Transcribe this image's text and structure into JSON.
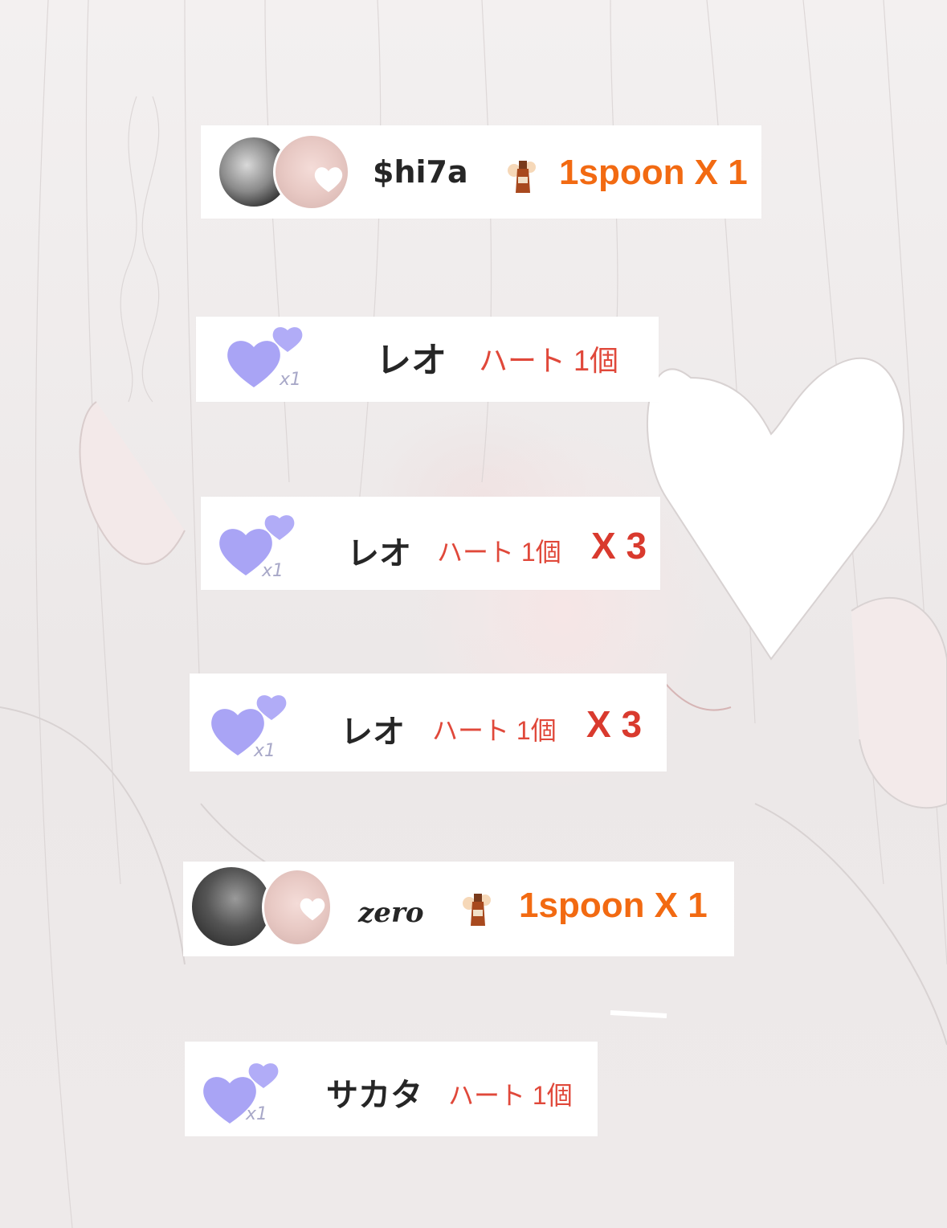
{
  "feed": [
    {
      "kind": "spoon",
      "username": "$hi7a",
      "gift_label": "1spoon X 1"
    },
    {
      "kind": "heart",
      "username": "レオ",
      "gift_label": "ハート 1個",
      "badge_count": "x1",
      "multiplier": ""
    },
    {
      "kind": "heart",
      "username": "レオ",
      "gift_label": "ハート 1個",
      "badge_count": "x1",
      "multiplier": "X 3"
    },
    {
      "kind": "heart",
      "username": "レオ",
      "gift_label": "ハート 1個",
      "badge_count": "x1",
      "multiplier": "X 3"
    },
    {
      "kind": "spoon",
      "username": "zero",
      "gift_label": "1spoon X 1"
    },
    {
      "kind": "heart",
      "username": "サカタ",
      "gift_label": "ハート 1個",
      "badge_count": "x1",
      "multiplier": ""
    }
  ],
  "colors": {
    "spoon_text": "#f26a12",
    "heart_text": "#e0483a",
    "multiplier": "#d93a2e",
    "heart_icon": "#a9a4f5"
  },
  "icons": {
    "heart_gift": "purple-double-heart-icon",
    "spoon_gift": "bottle-icon",
    "avatar_overlay": "white-heart-icon"
  }
}
